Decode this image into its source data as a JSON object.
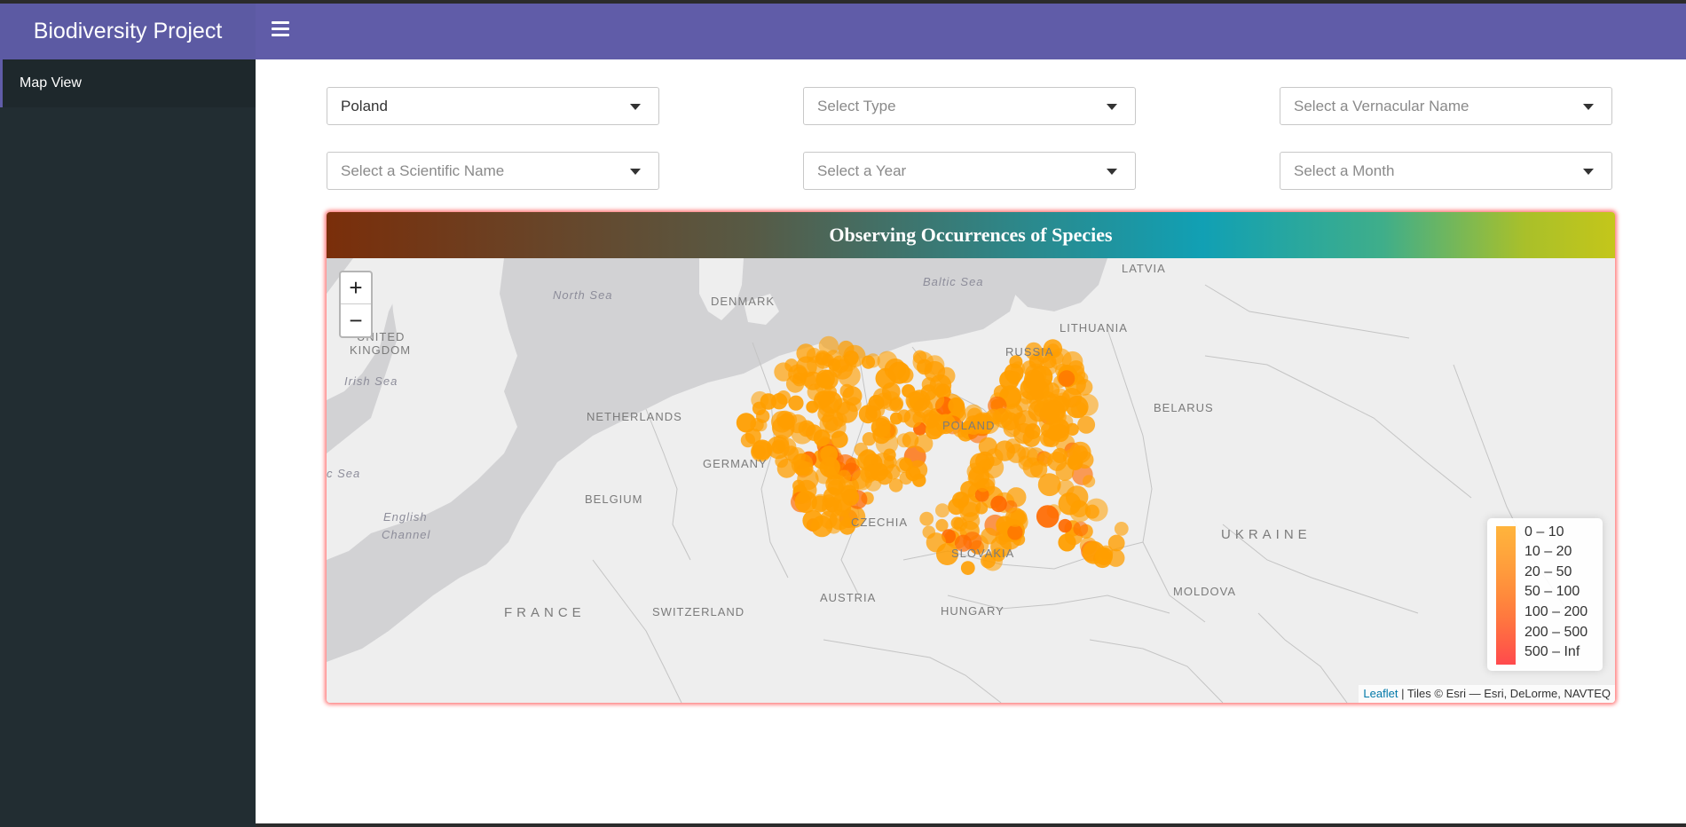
{
  "app": {
    "title": "Biodiversity Project"
  },
  "sidebar": {
    "items": [
      {
        "label": "Map View"
      }
    ]
  },
  "filters": {
    "country": {
      "value": "Poland"
    },
    "type": {
      "placeholder": "Select Type"
    },
    "vernacular": {
      "placeholder": "Select a Vernacular Name"
    },
    "scientific": {
      "placeholder": "Select a Scientific Name"
    },
    "year": {
      "placeholder": "Select a Year"
    },
    "month": {
      "placeholder": "Select a Month"
    }
  },
  "map": {
    "title": "Observing Occurrences of Species",
    "zoom_in": "+",
    "zoom_out": "−",
    "labels": {
      "north_sea": "North Sea",
      "baltic_sea": "Baltic Sea",
      "irish_sea": "Irish Sea",
      "celtic_sea": "c Sea",
      "english": "English",
      "channel": "Channel",
      "latvia": "LATVIA",
      "denmark": "DENMARK",
      "united": "UNITED",
      "kingdom": "KINGDOM",
      "lithuania": "LITHUANIA",
      "russia": "RUSSIA",
      "belarus": "BELARUS",
      "netherlands": "NETHERLANDS",
      "germany": "GERMANY",
      "poland": "POLAND",
      "belgium": "BELGIUM",
      "czechia": "CZECHIA",
      "slovakia": "SLOVAKIA",
      "ukraine": "UKRAINE",
      "france": "FRANCE",
      "switzerland": "SWITZERLAND",
      "austria": "AUSTRIA",
      "hungary": "HUNGARY",
      "moldova": "MOLDOVA"
    },
    "legend": [
      {
        "label": "0 – 10",
        "color": "#ffb43c"
      },
      {
        "label": "10 – 20",
        "color": "#ffa83c"
      },
      {
        "label": "20 – 50",
        "color": "#ff9a3c"
      },
      {
        "label": "50 – 100",
        "color": "#ff8a3c"
      },
      {
        "label": "100 – 200",
        "color": "#ff773f"
      },
      {
        "label": "200 – 500",
        "color": "#ff6145"
      },
      {
        "label": "500 – Inf",
        "color": "#ff4a4d"
      }
    ],
    "attribution": {
      "link": "Leaflet",
      "text": " | Tiles © Esri — Esri, DeLorme, NAVTEQ"
    },
    "colors": {
      "marker": "#ff9e00",
      "marker_dark": "#ff6a00",
      "water": "#d2d2d4",
      "land": "#eeeeee"
    }
  }
}
